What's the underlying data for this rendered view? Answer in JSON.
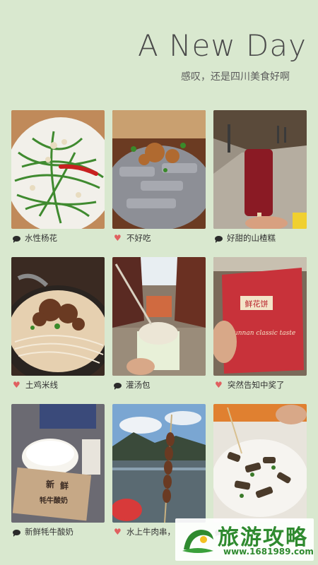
{
  "header": {
    "title": "A New Day",
    "subtitle": "感叹，还是四川美食好啊"
  },
  "cards": [
    {
      "caption": "水性杨花",
      "icon": "speech-bubble-icon"
    },
    {
      "caption": "不好吃",
      "icon": "heart-icon"
    },
    {
      "caption": "好甜的山楂糕",
      "icon": "speech-bubble-icon"
    },
    {
      "caption": "土鸡米线",
      "icon": "heart-icon"
    },
    {
      "caption": "灌汤包",
      "icon": "speech-bubble-icon"
    },
    {
      "caption": "突然告知中奖了",
      "icon": "heart-icon"
    },
    {
      "caption": "新鲜牦牛酸奶",
      "icon": "speech-bubble-icon"
    },
    {
      "caption": "水上牛肉串，",
      "icon": "heart-icon"
    },
    {
      "caption": "",
      "icon": "speech-bubble-icon"
    }
  ],
  "photo_texts": {
    "yogurt_sign_line1": "新",
    "yogurt_sign_line2": "鲜",
    "yogurt_sign_line3": "牦牛酸奶",
    "package_brand": "鲜花饼",
    "package_en": "Yunnan classic taste"
  },
  "watermark": {
    "name": "旅游攻略",
    "url": "www.1681989.com"
  },
  "colors": {
    "background": "#d9e8cf",
    "heart": "#e06060",
    "watermark_green": "#2f8a2f"
  }
}
